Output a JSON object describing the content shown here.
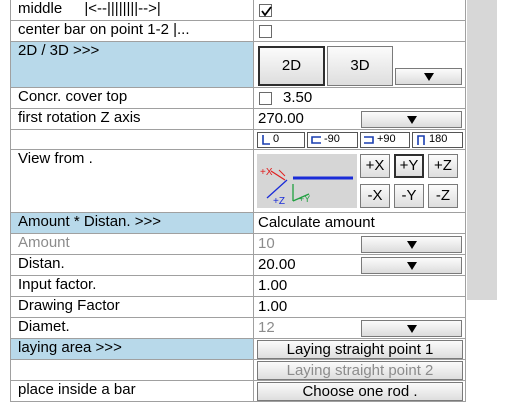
{
  "rows": {
    "middle": {
      "label": "middle",
      "ruler": "|<--||||||||-->|"
    },
    "center_bar": {
      "label": "center bar on point 1-2 |..."
    },
    "view_2d3d": {
      "label": "2D / 3D  >>>",
      "btn_2d": "2D",
      "btn_3d": "3D"
    },
    "cover": {
      "label": "Concr. cover top",
      "value": "3.50"
    },
    "rotation": {
      "label": "first rotation Z axis",
      "value": "270.00",
      "options": [
        "0",
        "-90",
        "+90",
        "180"
      ]
    },
    "view_from": {
      "label": "View from  .",
      "buttons": [
        "+X",
        "+Y",
        "+Z",
        "-X",
        "-Y",
        "-Z"
      ]
    },
    "amount_header": {
      "label": "Amount   * Distan.   >>>",
      "value": "Calculate amount"
    },
    "amount": {
      "label": "Amount",
      "value": "10"
    },
    "distan": {
      "label": "Distan.",
      "value": "20.00"
    },
    "input_factor": {
      "label": "Input factor.",
      "value": "1.00"
    },
    "drawing_factor": {
      "label": "Drawing Factor",
      "value": "1.00"
    },
    "diamet": {
      "label": "Diamet.",
      "value": "12"
    },
    "laying_area": {
      "label": "laying area  >>>",
      "button1": "Laying straight point 1",
      "button2": "Laying straight point 2"
    },
    "place_inside": {
      "label": "place inside a bar",
      "button": "Choose one rod  ."
    }
  },
  "colors": {
    "highlight": "#b8d9ea",
    "disabled_text": "#8c8c8c",
    "scrollbar": "#d7d7d7"
  }
}
